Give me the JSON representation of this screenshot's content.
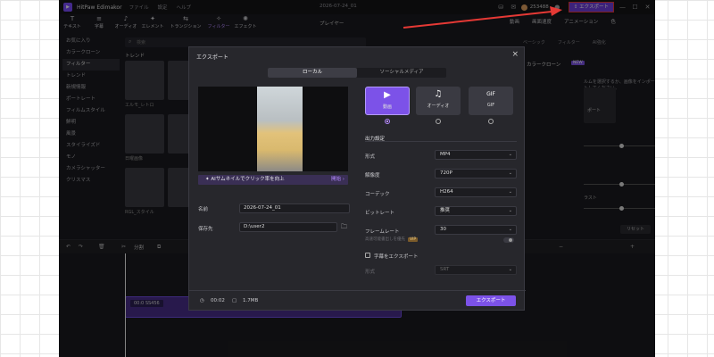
{
  "window": {
    "app_name": "HitPaw Edimakor",
    "menu": [
      "ファイル",
      "設定",
      "ヘルプ"
    ],
    "doc_title": "2026-07-24_01",
    "credits": "253488",
    "export_label": "エクスポート"
  },
  "toolbar": {
    "items": [
      {
        "icon": "T",
        "label": "テキスト"
      },
      {
        "icon": "≡",
        "label": "字幕"
      },
      {
        "icon": "♪",
        "label": "オーディオ"
      },
      {
        "icon": "✦",
        "label": "エレメント"
      },
      {
        "icon": "⇆",
        "label": "トランジション"
      },
      {
        "icon": "✧",
        "label": "フィルター"
      },
      {
        "icon": "✺",
        "label": "エフェクト"
      }
    ]
  },
  "left_panel": {
    "nav": [
      "お気に入り",
      "カラークローン",
      "フィルター",
      "トレンド",
      "新規情報",
      "ポートレート",
      "フィルムスタイル",
      "鮮明",
      "風景",
      "スタイライズド",
      "モノ",
      "カメラシャッター",
      "クリスマス"
    ],
    "search_placeholder": "検索",
    "section": "トレンド",
    "thumb_labels": [
      "エルモ_レトロ",
      "",
      "日曜画像",
      "",
      "RGL_スタイル",
      ""
    ]
  },
  "player_label": "プレイヤー",
  "right_panel": {
    "tabs": [
      "動画",
      "画面速度",
      "アニメーション",
      "色"
    ],
    "subtabs": [
      "ベーシック",
      "フィルター",
      "AI強化"
    ],
    "clone_label": "カラークローン",
    "clone_badge": "NEW",
    "hint": "ルムを選択するか、画像をインポートしてください。",
    "import_label": "ポート",
    "value1": "50",
    "unit1": "%",
    "value2": "0",
    "unit2": "%",
    "label3": "ラスト",
    "value3": "0",
    "unit3": "%",
    "reset": "リセット"
  },
  "timeline": {
    "split_label": "分割",
    "clip_label": "00:0 SS456"
  },
  "export_dialog": {
    "title": "エクスポート",
    "tabs": [
      "ローカル",
      "ソーシャルメディア"
    ],
    "active_tab": 0,
    "formats": [
      {
        "icon": "▶",
        "label": "動画",
        "selected": true
      },
      {
        "icon": "♫",
        "label": "オーディオ",
        "selected": false
      },
      {
        "icon": "GIF",
        "label": "GIF",
        "selected": false
      }
    ],
    "ai_banner": "AIサムネイルでクリック率を向上",
    "ai_button": "開始",
    "name_label": "名前",
    "name_value": "2026-07-24_01",
    "save_label": "保存先",
    "save_value": "D:\\user2",
    "section": "出力設定",
    "settings": [
      {
        "label": "形式",
        "value": "MP4"
      },
      {
        "label": "解像度",
        "value": "720P"
      },
      {
        "label": "コーデック",
        "value": "H264"
      },
      {
        "label": "ビットレート",
        "value": "推奨"
      },
      {
        "label": "フレームレート",
        "value": "30"
      }
    ],
    "gpu_label": "高速可能書出しを優先",
    "vip": "VIP",
    "subtitle_check": "字幕をエクスポート",
    "subtitle_format_label": "形式",
    "subtitle_format_value": "SRT",
    "duration": "00:02",
    "size": "1.7MB",
    "export_button": "エクスポート"
  },
  "colors": {
    "accent": "#7c52e8",
    "annotation": "#e53935"
  }
}
